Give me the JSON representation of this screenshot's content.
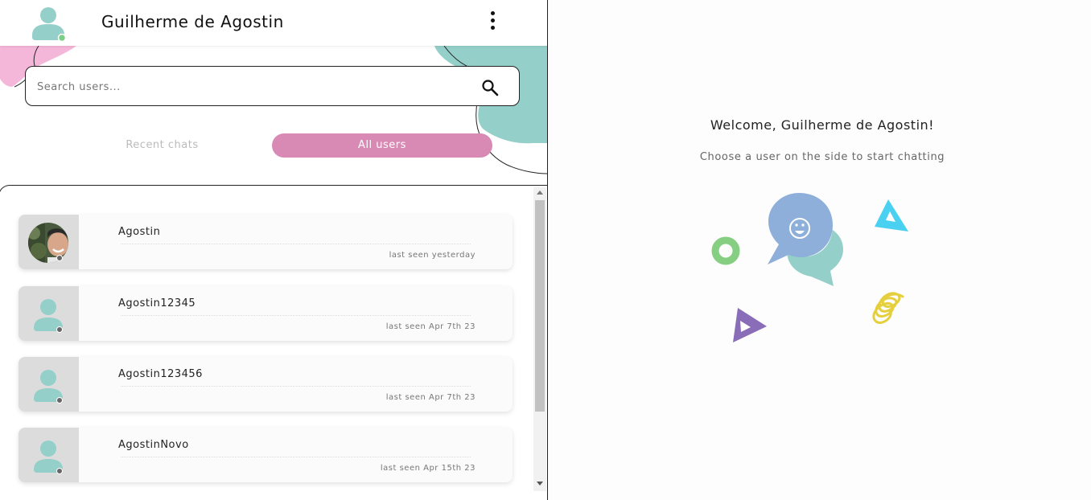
{
  "header": {
    "user_name": "Guilherme de Agostin",
    "online_color": "#7bcf86",
    "menu_icon": "more-vertical-icon"
  },
  "search": {
    "placeholder": "Search users...",
    "icon": "search-icon"
  },
  "tabs": [
    {
      "label": "Recent chats",
      "active": false
    },
    {
      "label": "All users",
      "active": true
    }
  ],
  "users": [
    {
      "name": "Agostin",
      "last_seen": "last seen yesterday",
      "has_photo": true
    },
    {
      "name": "Agostin12345",
      "last_seen": "last seen Apr 7th 23",
      "has_photo": false
    },
    {
      "name": "Agostin123456",
      "last_seen": "last seen Apr 7th 23",
      "has_photo": false
    },
    {
      "name": "AgostinNovo",
      "last_seen": "last seen Apr 15th 23",
      "has_photo": false
    }
  ],
  "welcome": {
    "title": "Welcome, Guilherme de Agostin!",
    "subtitle": "Choose a user on the side to start chatting"
  },
  "colors": {
    "accent_pink": "#d98ab4",
    "teal": "#94cfc9",
    "blob_pink": "#f4b6d9",
    "bubble_blue": "#8eafd9",
    "triangle_cyan": "#4ad0f0",
    "triangle_purple": "#8a6db8",
    "ring_green": "#86cf82",
    "spring_yellow": "#e6cf3c"
  }
}
